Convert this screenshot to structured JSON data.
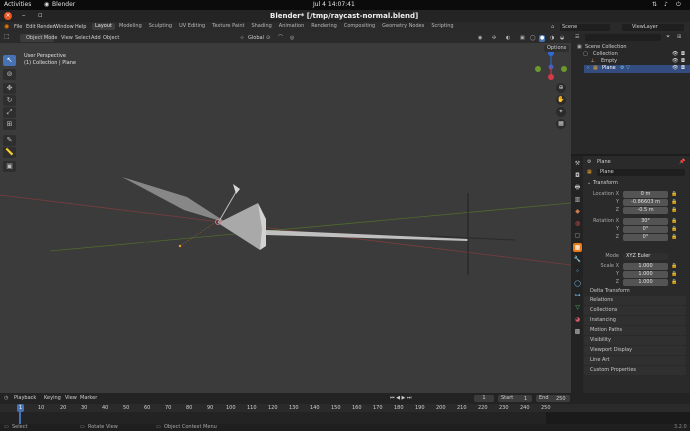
{
  "gnome": {
    "activities": "Activities",
    "app": "Blender",
    "clock": "Jul 4  14:07:41"
  },
  "window": {
    "title": "Blender* [/tmp/raycast-normal.blend]"
  },
  "menus": [
    "File",
    "Edit",
    "Render",
    "Window",
    "Help"
  ],
  "workspaces": [
    "Layout",
    "Modeling",
    "Sculpting",
    "UV Editing",
    "Texture Paint",
    "Shading",
    "Animation",
    "Rendering",
    "Compositing",
    "Geometry Nodes",
    "Scripting"
  ],
  "scene": {
    "scene_label": "Scene",
    "viewlayer_label": "ViewLayer"
  },
  "viewport_header": {
    "mode": "Object Mode",
    "menu": [
      "View",
      "Select",
      "Add",
      "Object"
    ],
    "transform": "Global",
    "options": "Options"
  },
  "viewport": {
    "perspective": "User Perspective",
    "collection": "(1) Collection | Plane"
  },
  "outliner": {
    "scene_collection": "Scene Collection",
    "items": [
      "Collection",
      "Empty",
      "Plane"
    ]
  },
  "properties": {
    "object_name": "Plane",
    "name_field": "Plane",
    "transform_header": "Transform",
    "location": {
      "label": "Location X",
      "x": "0 m",
      "y": "-0.86603 m",
      "z": "-0.5 m"
    },
    "rotation": {
      "label": "Rotation X",
      "x": "30°",
      "y": "0°",
      "z": "0°"
    },
    "mode_label": "Mode",
    "mode_value": "XYZ Euler",
    "scale": {
      "label": "Scale X",
      "x": "1.000",
      "y": "1.000",
      "z": "1.000"
    },
    "axis_y": "Y",
    "axis_z": "Z",
    "panels": [
      "Delta Transform",
      "Relations",
      "Collections",
      "Instancing",
      "Motion Paths",
      "Visibility",
      "Viewport Display",
      "Line Art",
      "Custom Properties"
    ]
  },
  "timeline": {
    "menu": [
      "Playback",
      "Keying",
      "View",
      "Marker"
    ],
    "current_frame": "1",
    "start_label": "Start",
    "start": "1",
    "end_label": "End",
    "end": "250",
    "ruler": [
      "1",
      "10",
      "20",
      "30",
      "40",
      "50",
      "60",
      "70",
      "80",
      "90",
      "100",
      "110",
      "120",
      "130",
      "140",
      "150",
      "160",
      "170",
      "180",
      "190",
      "200",
      "210",
      "220",
      "230",
      "240",
      "250"
    ]
  },
  "status": {
    "select": "Select",
    "rotate": "Rotate View",
    "context": "Object Context Menu",
    "version": "3.2.0"
  }
}
